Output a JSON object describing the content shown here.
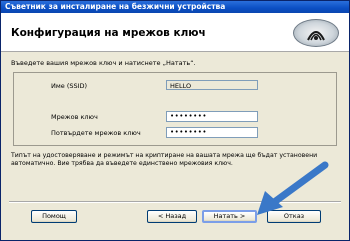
{
  "window": {
    "title": "Съветник за инсталиране на безжични устройства"
  },
  "header": {
    "title": "Конфигурация на мрежов ключ",
    "logo_icon": "brother-wireless-logo"
  },
  "main": {
    "instruction": "Въведете вашия мрежов ключ и натиснете „Натать“.",
    "ssid_label": "Име (SSID)",
    "ssid_value": "HELLO",
    "key_label": "Мрежов ключ",
    "key_value": "••••••••",
    "confirm_label": "Потвърдете мрежов ключ",
    "confirm_value": "••••••••",
    "notice": "Типът на удостоверяване и режимът на криптиране на вашата мрежа ще бъдат установени автоматично. Вие трябва да въведете единствено мрежовия ключ."
  },
  "footer": {
    "help_label": "Помощ",
    "back_label": "< Назад",
    "next_label": "Натать >",
    "cancel_label": "Отказ"
  },
  "colors": {
    "titlebar": "#0b4fc4",
    "dialog_bg": "#ece9d8",
    "arrow": "#3a78c8"
  }
}
